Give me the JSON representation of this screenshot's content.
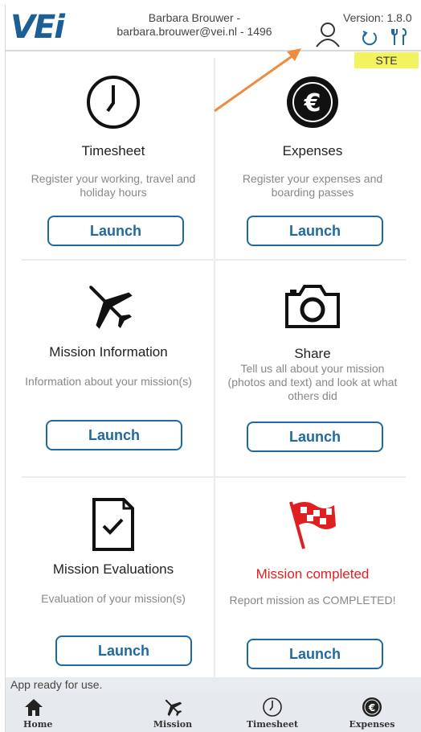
{
  "header": {
    "logo": "VEi",
    "user_name": "Barbara  Brouwer -",
    "user_email": "barbara.brouwer@vei.nl - 1496",
    "version": "Version: 1.8.0",
    "environment": "STE"
  },
  "tiles": [
    {
      "title": "Timesheet",
      "description": "Register your working, travel and holiday hours",
      "button": "Launch",
      "icon": "clock-icon"
    },
    {
      "title": "Expenses",
      "description": "Register your expenses and boarding passes",
      "button": "Launch",
      "icon": "euro-icon"
    },
    {
      "title": "Mission Information",
      "description": "Information about your mission(s)",
      "button": "Launch",
      "icon": "airplane-icon"
    },
    {
      "title": "Share",
      "description": "Tell us all about your mission (photos and text) and look at what others did",
      "button": "Launch",
      "icon": "camera-icon"
    },
    {
      "title": "Mission Evaluations",
      "description": "Evaluation of your mission(s)",
      "button": "Launch",
      "icon": "document-check-icon"
    },
    {
      "title": "Mission completed",
      "description": "Report mission as COMPLETED!",
      "button": "Launch",
      "icon": "checkered-flag-icon"
    }
  ],
  "colors": {
    "accent": "#1e6aa0",
    "completed": "#e02020",
    "badge": "#f3f35f",
    "arrow": "#f08a3c"
  },
  "status": "App ready for use.",
  "nav": [
    {
      "label": "Home",
      "icon": "home-icon"
    },
    {
      "label": "Mission",
      "icon": "airplane-icon"
    },
    {
      "label": "Timesheet",
      "icon": "clock-icon"
    },
    {
      "label": "Expenses",
      "icon": "euro-icon"
    }
  ]
}
